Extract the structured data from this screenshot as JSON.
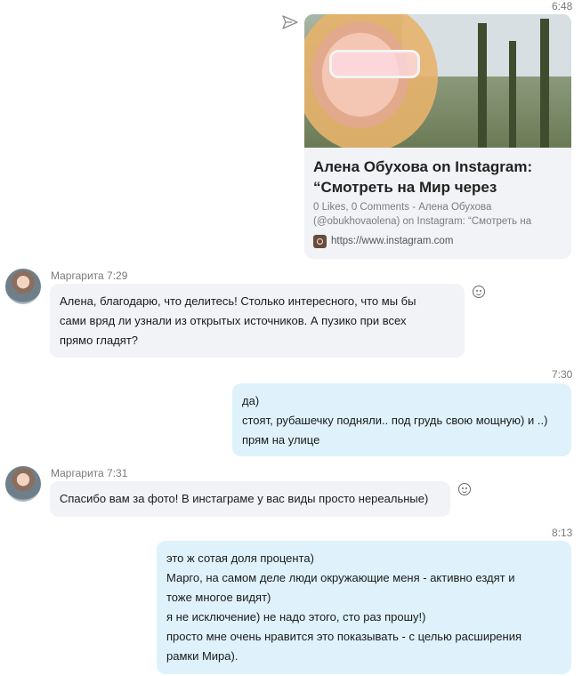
{
  "messages": {
    "m1": {
      "time": "6:48"
    },
    "card": {
      "title": "Алена Обухова on Instagram: “Смотреть на Мир через",
      "desc": "0 Likes, 0 Comments - Алена Обухова (@obukhovaolena) on Instagram: “Смотреть на",
      "url": "https://www.instagram.com"
    },
    "m2": {
      "sender": "Маргарита",
      "time": "7:29",
      "text": [
        "Алена, благодарю, что делитесь! Столько интересного, что мы бы",
        "сами вряд ли узнали из открытых источников. А пузико при всех",
        "прямо гладят?"
      ]
    },
    "m3": {
      "time": "7:30",
      "text": [
        "да)",
        "стоят, рубашечку подняли.. под грудь свою мощную) и ..)",
        "прям на улице"
      ]
    },
    "m4": {
      "sender": "Маргарита",
      "time": "7:31",
      "text": "Спасибо вам за фото! В инстаграме у вас виды просто нереальные)"
    },
    "m5": {
      "time": "8:13",
      "text": [
        "это ж сотая доля процента)",
        "Марго, на самом деле люди окружающие меня - активно ездят и",
        "тоже многое видят)",
        "я не исключение) не надо этого, сто раз прошу!)",
        "просто мне очень нравится это показывать - с целью расширения",
        "рамки Мира)."
      ]
    }
  }
}
